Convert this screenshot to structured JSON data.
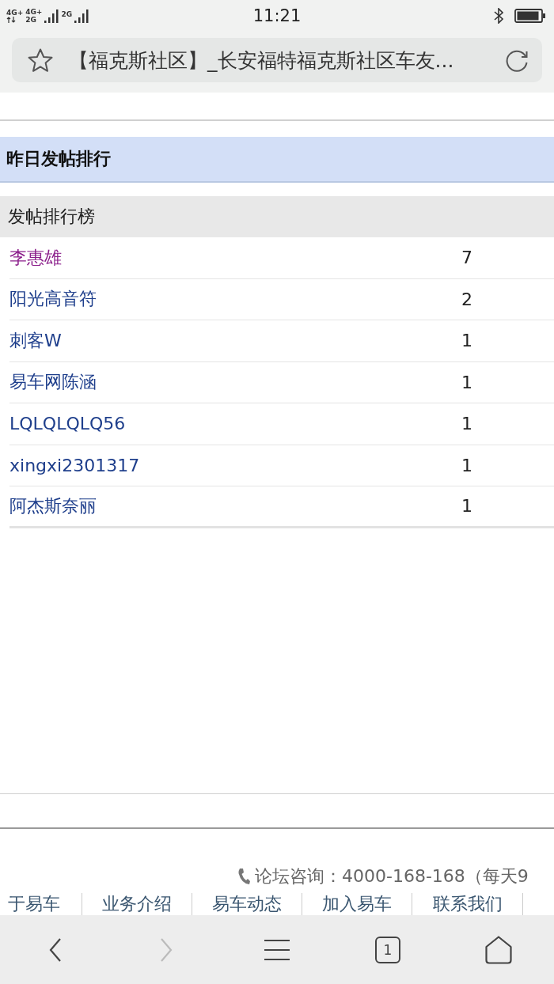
{
  "status_bar": {
    "network_labels": [
      "4G+",
      "4G+",
      "2G",
      "2G"
    ],
    "time": "11:21"
  },
  "address_bar": {
    "title": "【福克斯社区】_长安福特福克斯社区车友..."
  },
  "section": {
    "title": "昨日发帖排行"
  },
  "ranking": {
    "heading": "发帖排行榜",
    "rows": [
      {
        "name": "李惠雄",
        "count": "7",
        "visited": true
      },
      {
        "name": "阳光高音符",
        "count": "2",
        "visited": false
      },
      {
        "name": "刺客W",
        "count": "1",
        "visited": false
      },
      {
        "name": "易车网陈涵",
        "count": "1",
        "visited": false
      },
      {
        "name": "LQLQLQLQ56",
        "count": "1",
        "visited": false
      },
      {
        "name": "xingxi2301317",
        "count": "1",
        "visited": false
      },
      {
        "name": "阿杰斯奈丽",
        "count": "1",
        "visited": false
      }
    ]
  },
  "footer": {
    "phone": "论坛咨询：4000-168-168（每天9",
    "links": [
      "于易车",
      "业务介绍",
      "易车动态",
      "加入易车",
      "联系我们"
    ]
  },
  "toolbar": [
    {
      "kind": "back",
      "disabled": false
    },
    {
      "kind": "forward",
      "disabled": true
    },
    {
      "kind": "menu",
      "disabled": false
    },
    {
      "kind": "tabs",
      "count": "1",
      "disabled": false
    },
    {
      "kind": "home",
      "disabled": false
    }
  ]
}
